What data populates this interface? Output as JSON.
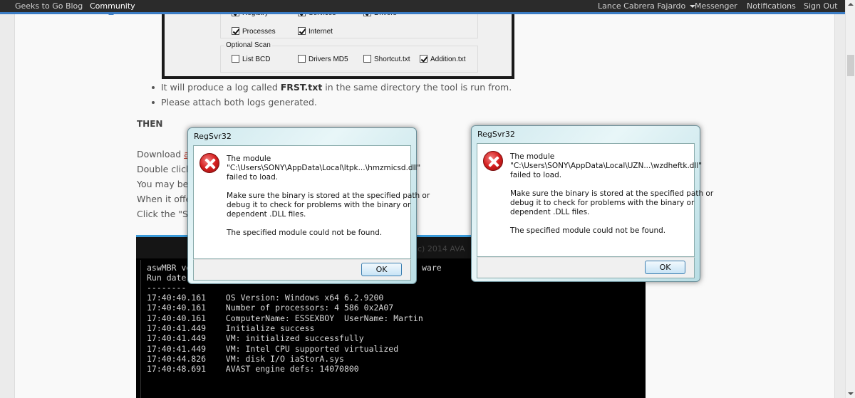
{
  "navbar": {
    "left_links": [
      {
        "label": "Geeks to Go Blog",
        "active": false
      },
      {
        "label": "Community",
        "active": true
      }
    ],
    "user_menu": "Lance Cabrera Fajardo",
    "right_links": [
      "Messenger",
      "Notifications",
      "Sign Out"
    ],
    "accent_color": "#3b7cc4"
  },
  "frst_screenshot": {
    "whitelist_row1": [
      {
        "label": "Registry",
        "checked": true
      },
      {
        "label": "Services",
        "checked": true
      },
      {
        "label": "Drivers",
        "checked": true
      }
    ],
    "whitelist_row2": [
      {
        "label": "Processes",
        "checked": true
      },
      {
        "label": "Internet",
        "checked": true
      }
    ],
    "optional_scan": {
      "label": "Optional Scan",
      "items": [
        {
          "label": "List BCD",
          "checked": false
        },
        {
          "label": "Drivers MD5",
          "checked": false
        },
        {
          "label": "Shortcut.txt",
          "checked": false
        },
        {
          "label": "Addition.txt",
          "checked": true
        }
      ]
    }
  },
  "post": {
    "bullets": [
      {
        "pre": "It will produce a log called ",
        "bold": "FRST.txt",
        "post": " in the same directory the tool is run from."
      },
      {
        "pre": "Please attach both logs generated.",
        "bold": "",
        "post": ""
      }
    ],
    "then_heading": "THEN",
    "instructions": [
      {
        "text": "Download ",
        "link": "as"
      },
      {
        "text": "Double click",
        "link": ""
      },
      {
        "text": "You may be",
        "link": ""
      },
      {
        "text": "When it offe",
        "link": ""
      },
      {
        "text": "Click the \"Sc",
        "link": ""
      }
    ]
  },
  "console": {
    "copyright": "c) 2014 AVA",
    "header_lines": [
      "aswMBR ve",
      "Run date",
      "--------"
    ],
    "header_right": "ware",
    "log": [
      {
        "time": "17:40:40.161",
        "msg": "OS Version: Windows x64 6.2.9200"
      },
      {
        "time": "17:40:40.161",
        "msg": "Number of processors: 4 586 0x2A07"
      },
      {
        "time": "17:40:40.161",
        "msg": "ComputerName: ESSEXBOY  UserName: Martin"
      },
      {
        "time": "17:40:41.449",
        "msg": "Initialize success"
      },
      {
        "time": "17:40:41.449",
        "msg": "VM: initialized successfully"
      },
      {
        "time": "17:40:41.449",
        "msg": "VM: Intel CPU supported virtualized"
      },
      {
        "time": "17:40:44.826",
        "msg": "VM: disk I/O iaStorA.sys"
      },
      {
        "time": "17:40:48.691",
        "msg": "AVAST engine defs: 14070800"
      }
    ]
  },
  "dialogs": [
    {
      "title": "RegSvr32",
      "icon": "error-icon",
      "line1": "The module",
      "line2": "\"C:\\Users\\SONY\\AppData\\Local\\ltpk...\\hmzmicsd.dll\"",
      "line3": "failed to load.",
      "line4": "Make sure the binary is stored at the specified path or",
      "line5": "debug it to check for problems with the binary or",
      "line6": "dependent .DLL files.",
      "line7": "The specified module could not be found.",
      "ok_label": "OK"
    },
    {
      "title": "RegSvr32",
      "icon": "error-icon",
      "line1": "The module",
      "line2": "\"C:\\Users\\SONY\\AppData\\Local\\UZN...\\wzdheftk.dll\"",
      "line3": "failed to load.",
      "line4": "Make sure the binary is stored at the specified path or",
      "line5": "debug it to check for problems with the binary or",
      "line6": "dependent .DLL files.",
      "line7": "The specified module could not be found.",
      "ok_label": "OK"
    }
  ]
}
